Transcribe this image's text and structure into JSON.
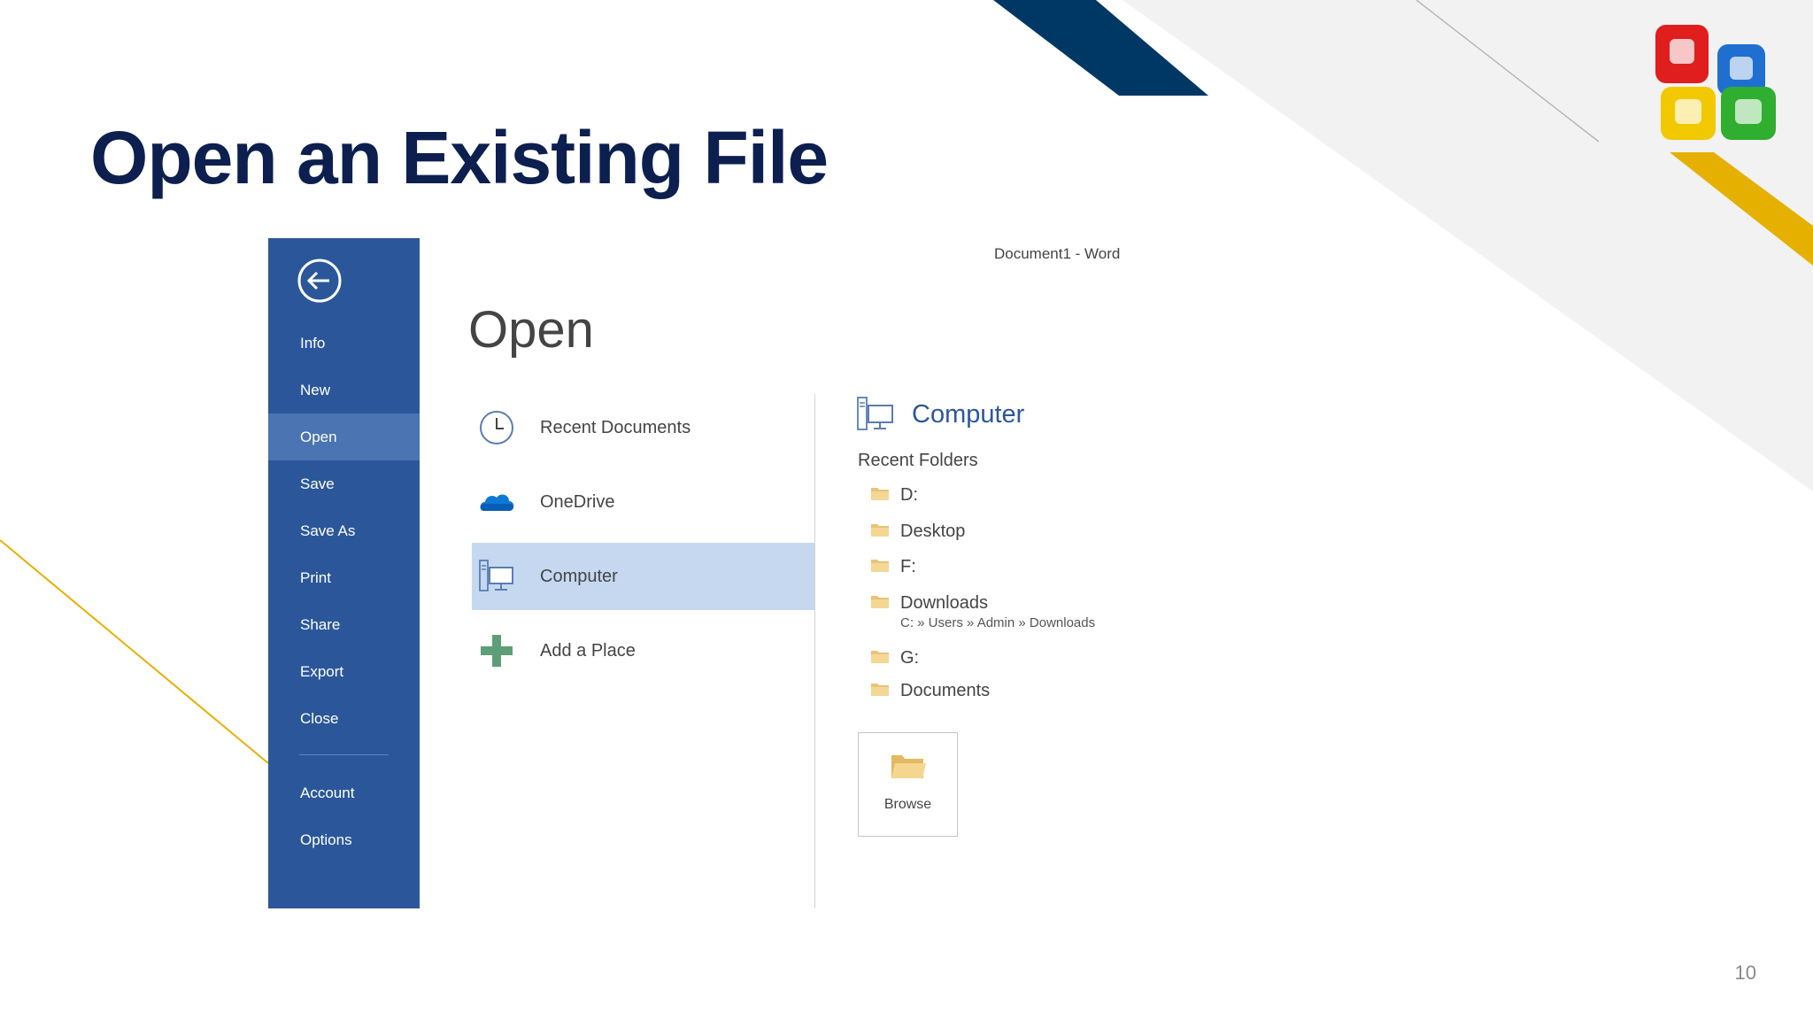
{
  "slide": {
    "title": "Open an Existing File",
    "page_number": "10",
    "colors": {
      "title": "#0c1f4f",
      "navy_band": "#003865",
      "gold_band": "#e6b000",
      "gray_band": "#f2f2f2"
    }
  },
  "window": {
    "title": "Document1 - Word",
    "heading": "Open"
  },
  "sidebar": {
    "back_icon": "back-arrow-icon",
    "items": [
      {
        "label": "Info"
      },
      {
        "label": "New"
      },
      {
        "label": "Open",
        "active": true
      },
      {
        "label": "Save"
      },
      {
        "label": "Save As"
      },
      {
        "label": "Print"
      },
      {
        "label": "Share"
      },
      {
        "label": "Export"
      },
      {
        "label": "Close"
      },
      {
        "label": "Account"
      },
      {
        "label": "Options"
      }
    ],
    "color": "#2b579a",
    "active_color": "#4a74b2"
  },
  "locations": [
    {
      "label": "Recent Documents",
      "icon": "clock-icon"
    },
    {
      "label": "OneDrive",
      "icon": "cloud-icon"
    },
    {
      "label": "Computer",
      "icon": "computer-icon",
      "selected": true
    },
    {
      "label": "Add a Place",
      "icon": "plus-icon"
    }
  ],
  "right_panel": {
    "heading": "Computer",
    "heading_icon": "computer-icon",
    "recent_folders_label": "Recent Folders",
    "folders": [
      {
        "name": "D:"
      },
      {
        "name": "Desktop"
      },
      {
        "name": "F:"
      },
      {
        "name": "Downloads",
        "path": "C: » Users » Admin » Downloads"
      },
      {
        "name": "G:"
      },
      {
        "name": "Documents"
      }
    ],
    "browse_label": "Browse",
    "browse_icon": "open-folder-icon"
  }
}
